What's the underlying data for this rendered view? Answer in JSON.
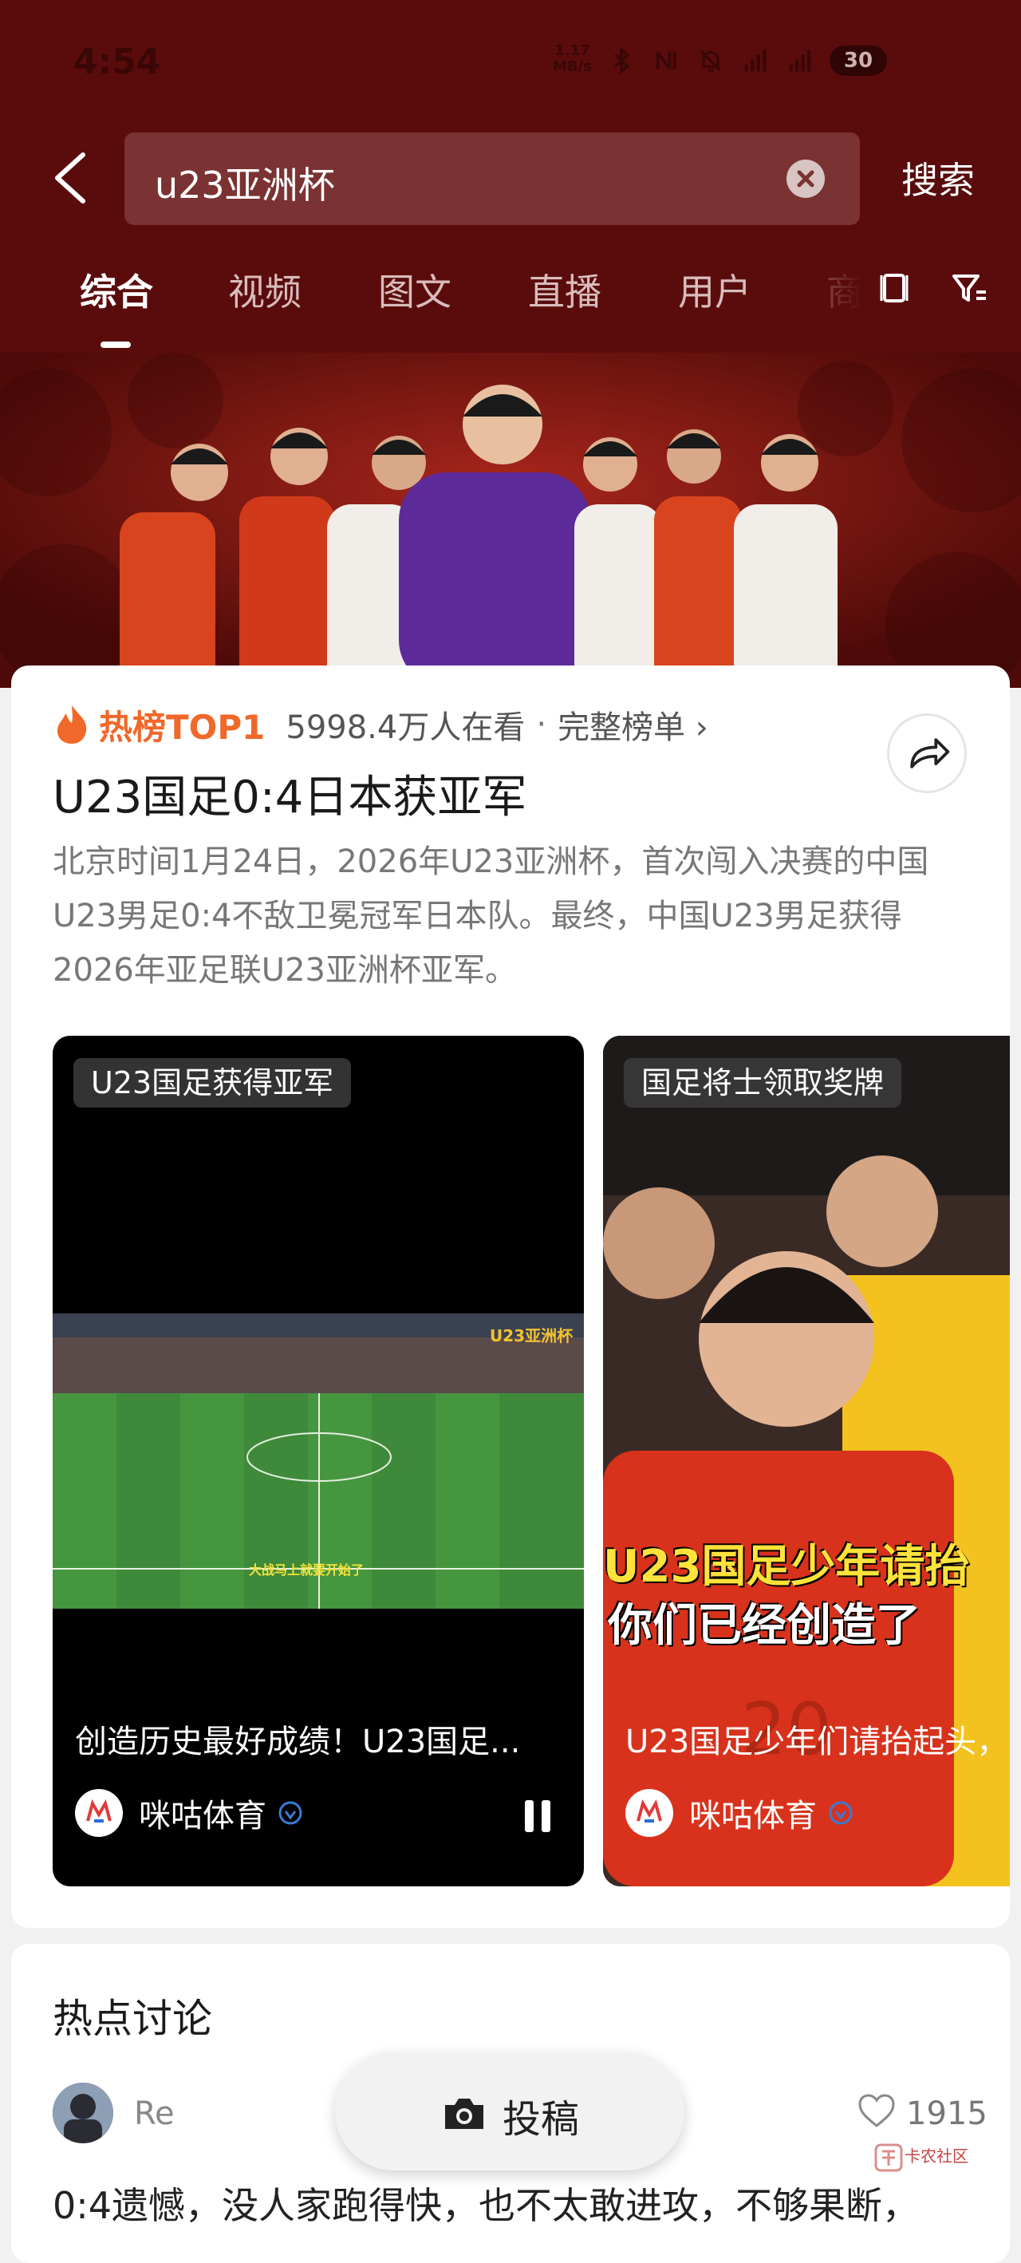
{
  "status_bar": {
    "time": "4:54",
    "net_speed_value": "1.17",
    "net_speed_unit": "MB/s",
    "battery": "30"
  },
  "search": {
    "query": "u23亚洲杯",
    "button_label": "搜索"
  },
  "tabs": [
    {
      "label": "综合",
      "active": true
    },
    {
      "label": "视频",
      "active": false
    },
    {
      "label": "图文",
      "active": false
    },
    {
      "label": "直播",
      "active": false
    },
    {
      "label": "用户",
      "active": false
    },
    {
      "label": "商",
      "active": false
    }
  ],
  "hot": {
    "label": "热榜TOP1",
    "viewers": "5998.4万人在看",
    "separator": "·",
    "link": "完整榜单 ›"
  },
  "card": {
    "title": "U23国足0:4日本获亚军",
    "description_lines": [
      "北京时间1月24日，2026年U23亚洲杯，首次闯入决赛的中国",
      "U23男足0:4不敌卫冕冠军日本队。最终，中国U23男足获得",
      "2026年亚足联U23亚洲杯亚军。"
    ]
  },
  "videos": [
    {
      "tag": "U23国足获得亚军",
      "caption": "创造历史最好成绩！U23国足...",
      "author": "咪咕体育",
      "overlay_badge": "U23亚洲杯",
      "subtitle": "大战马上就要开始了"
    },
    {
      "tag": "国足将士领取奖牌",
      "caption": "U23国足少年们请抬起头，",
      "author": "咪咕体育",
      "overlay_line1": "U23国足少年请抬",
      "overlay_line2": "你们已经创造了"
    }
  ],
  "discussion": {
    "title": "热点讨论",
    "user": "Re",
    "likes": "1915",
    "text": "0:4遗憾，没人家跑得快，也不太敢进攻，不够果断，"
  },
  "post_button": {
    "label": "投稿"
  },
  "watermark": "卡农社区",
  "colors": {
    "header_bg": "#5a0c0c",
    "hot_orange": "#f0682a",
    "verified_blue": "#3a7bd5"
  }
}
